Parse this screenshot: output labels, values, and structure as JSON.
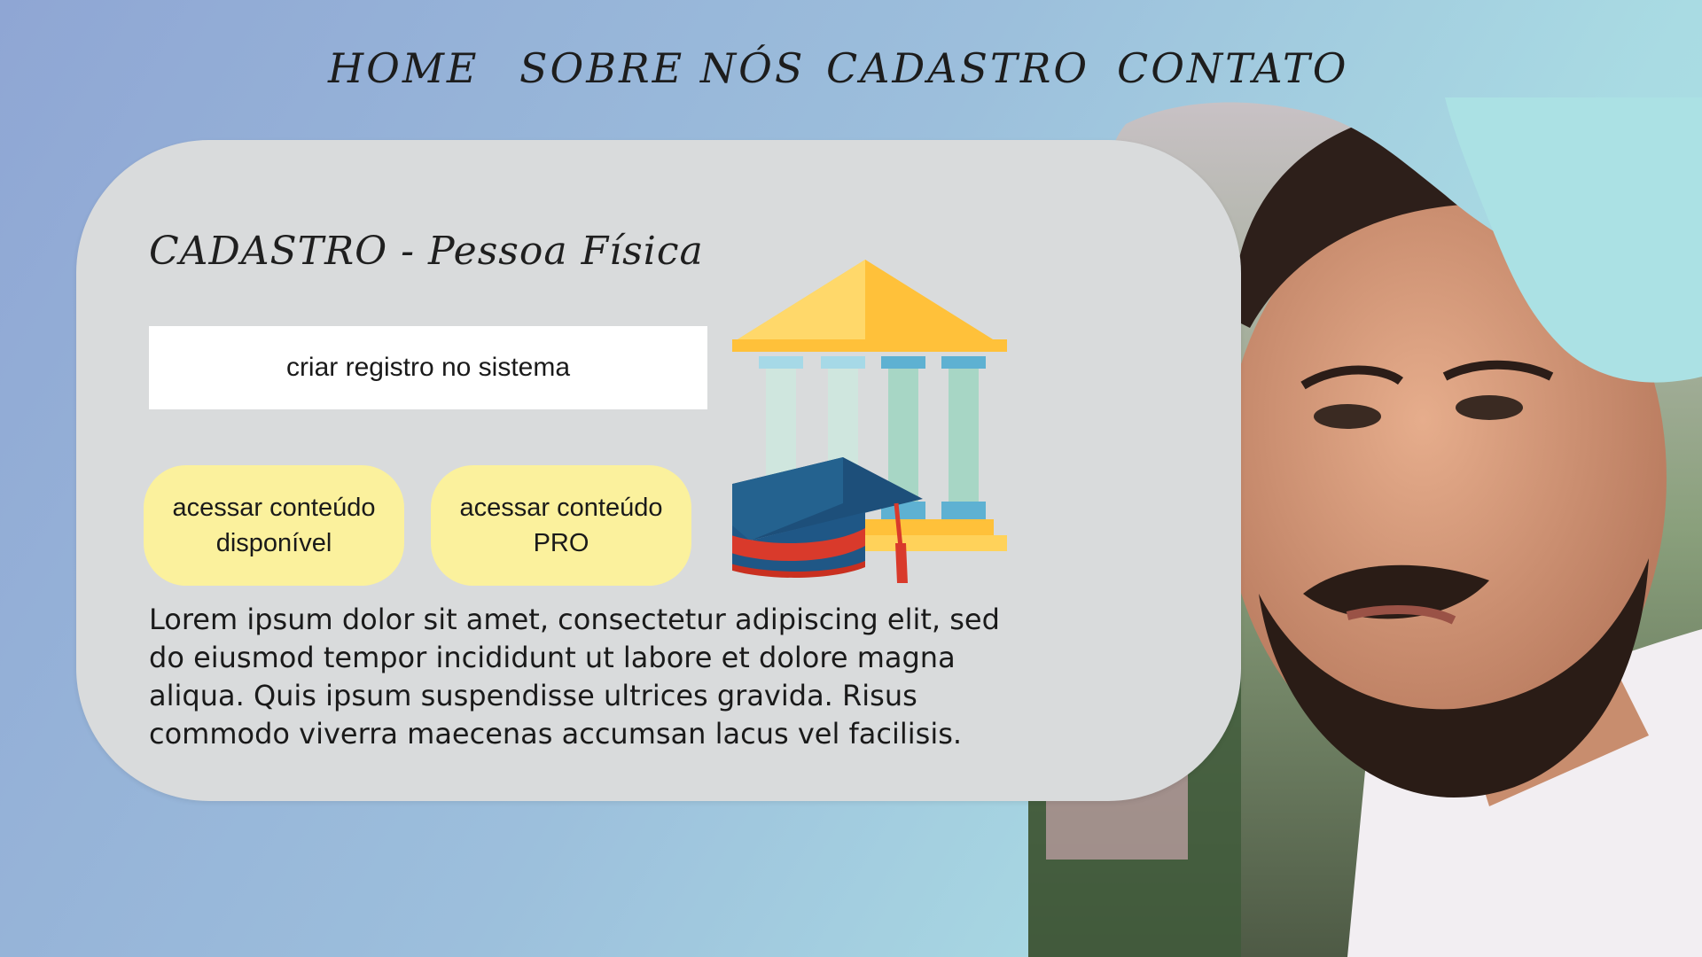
{
  "nav": {
    "items": [
      {
        "label": "HOME"
      },
      {
        "label": "SOBRE NÓS"
      },
      {
        "label": "CADASTRO"
      },
      {
        "label": "CONTATO"
      }
    ]
  },
  "card": {
    "title": "CADASTRO - Pessoa Física",
    "register_button": "criar registro no sistema",
    "buttons": [
      {
        "label": "acessar conteúdo disponível"
      },
      {
        "label": "acessar conteúdo PRO"
      }
    ],
    "body": "Lorem ipsum dolor sit amet, consectetur adipiscing elit, sed do eiusmod tempor incididunt ut labore et dolore magna aliqua. Quis ipsum suspendisse ultrices gravida. Risus commodo viverra maecenas accumsan lacus vel facilisis.",
    "illustration_icon": "university-graduation-icon"
  },
  "colors": {
    "pill_yellow": "#fbf19d",
    "card_gray": "#d9dbdc",
    "accent_teal": "#abe1e4"
  }
}
